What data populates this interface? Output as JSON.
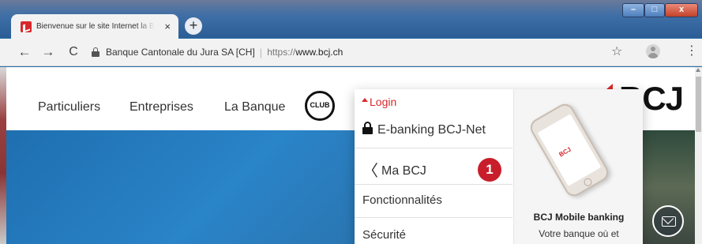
{
  "browser": {
    "tab_title": "Bienvenue sur le site Internet la BCJ",
    "tab_close": "×",
    "new_tab": "+",
    "window_min": "–",
    "window_max": "□",
    "window_close": "x",
    "nav_back": "←",
    "nav_forward": "→",
    "nav_reload": "C",
    "origin": "Banque Cantonale du Jura SA [CH]",
    "separator": "|",
    "url_scheme": "https://",
    "url_host": "www.bcj.ch",
    "bookmark": "☆",
    "menu": "⋮"
  },
  "site": {
    "nav": [
      "Particuliers",
      "Entreprises",
      "La Banque"
    ],
    "club_label": "CLUB",
    "logo_text": "BCJ",
    "brand_color": "#d8282c"
  },
  "login_menu": {
    "label": "Login",
    "items": [
      {
        "label": "E-banking BCJ-Net",
        "icon": "lock-icon"
      },
      {
        "label": "Ma BCJ",
        "icon": "bcj-chevron-icon"
      },
      {
        "label": "Fonctionnalités"
      },
      {
        "label": "Sécurité"
      }
    ],
    "badge": "1",
    "badge_color": "#c81e2b",
    "promo_title": "BCJ Mobile banking",
    "promo_text": "Votre banque où et",
    "phone_logo": "BCJ"
  }
}
